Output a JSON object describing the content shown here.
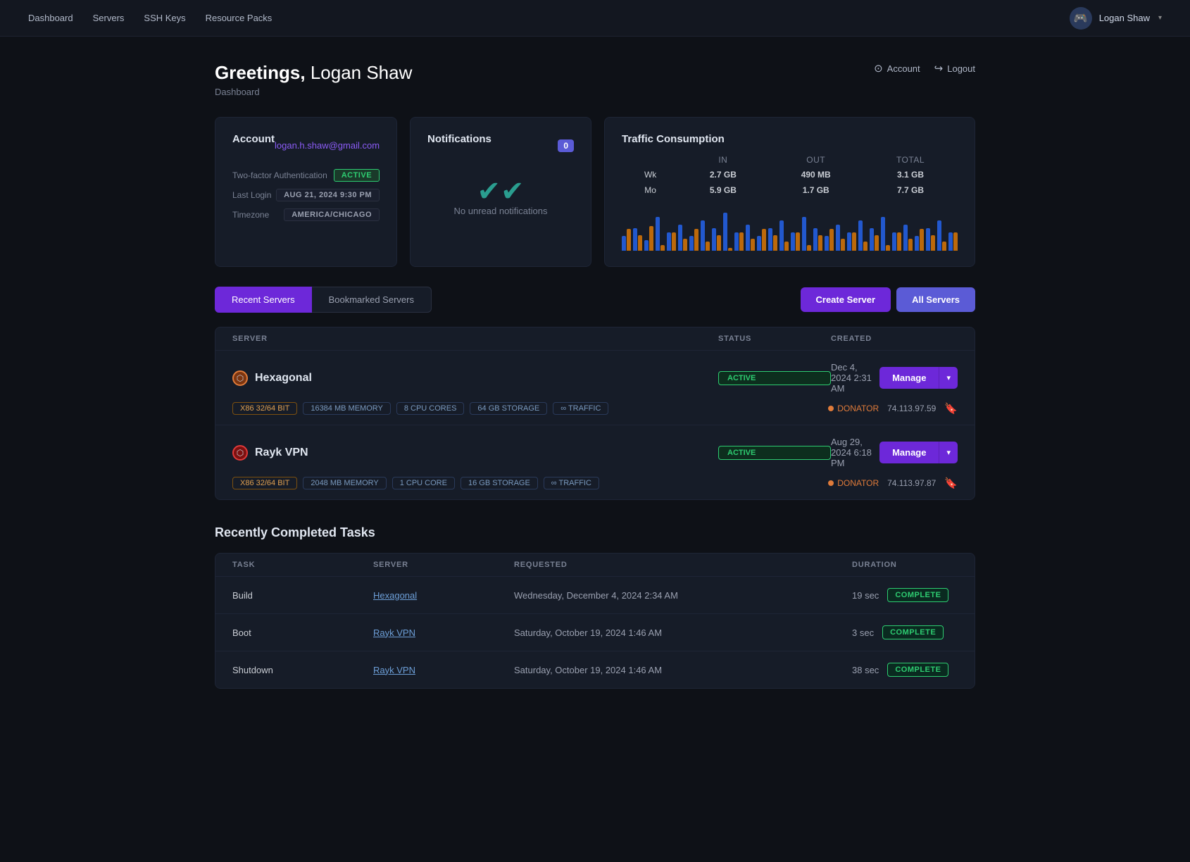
{
  "nav": {
    "links": [
      "Dashboard",
      "Servers",
      "SSH Keys",
      "Resource Packs"
    ],
    "username": "Logan Shaw",
    "avatar_emoji": "🎮"
  },
  "page_header": {
    "greeting": "Greetings,",
    "username": " Logan Shaw",
    "subtitle": "Dashboard",
    "actions": {
      "account_label": "Account",
      "logout_label": "Logout"
    }
  },
  "account_card": {
    "title": "Account",
    "email": "logan.h.shaw@gmail.com",
    "two_factor_label": "Two-factor Authentication",
    "two_factor_status": "ACTIVE",
    "last_login_label": "Last Login",
    "last_login_value": "AUG 21, 2024 9:30 PM",
    "timezone_label": "Timezone",
    "timezone_value": "AMERICA/CHICAGO"
  },
  "notifications_card": {
    "title": "Notifications",
    "count": "0",
    "empty_text": "No unread notifications"
  },
  "traffic_card": {
    "title": "Traffic Consumption",
    "headers": [
      "",
      "IN",
      "OUT",
      "TOTAL"
    ],
    "rows": [
      {
        "label": "Wk",
        "in": "2.7 GB",
        "out": "490 MB",
        "total": "3.1 GB"
      },
      {
        "label": "Mo",
        "in": "5.9 GB",
        "out": "1.7 GB",
        "total": "7.7 GB"
      }
    ],
    "chart_bars": [
      3,
      5,
      2,
      8,
      4,
      6,
      3,
      7,
      5,
      9,
      4,
      6,
      3,
      5,
      7,
      4,
      8,
      5,
      3,
      6,
      4,
      7,
      5,
      8,
      4,
      6,
      3,
      5,
      7,
      4
    ]
  },
  "tabs": {
    "active": "Recent Servers",
    "inactive": "Bookmarked Servers"
  },
  "buttons": {
    "create_server": "Create Server",
    "all_servers": "All Servers"
  },
  "servers_table": {
    "headers": {
      "server": "SERVER",
      "status": "STATUS",
      "created": "CREATED"
    },
    "rows": [
      {
        "icon_color": "orange",
        "name": "Hexagonal",
        "status": "ACTIVE",
        "created": "Dec 4, 2024 2:31 AM",
        "tags": [
          "X86 32/64 BIT",
          "16384 MB MEMORY",
          "8 CPU CORES",
          "64 GB STORAGE",
          "∞ TRAFFIC"
        ],
        "donator": "DONATOR",
        "ip": "74.113.97.59"
      },
      {
        "icon_color": "red",
        "name": "Rayk VPN",
        "status": "ACTIVE",
        "created": "Aug 29, 2024 6:18 PM",
        "tags": [
          "X86 32/64 BIT",
          "2048 MB MEMORY",
          "1 CPU CORE",
          "16 GB STORAGE",
          "∞ TRAFFIC"
        ],
        "donator": "DONATOR",
        "ip": "74.113.97.87"
      }
    ]
  },
  "tasks_section": {
    "title": "Recently Completed Tasks",
    "headers": {
      "task": "TASK",
      "server": "SERVER",
      "requested": "REQUESTED",
      "duration": "DURATION"
    },
    "rows": [
      {
        "task": "Build",
        "server": "Hexagonal",
        "requested": "Wednesday, December 4, 2024 2:34 AM",
        "duration": "19 sec",
        "status": "COMPLETE"
      },
      {
        "task": "Boot",
        "server": "Rayk VPN",
        "requested": "Saturday, October 19, 2024 1:46 AM",
        "duration": "3 sec",
        "status": "COMPLETE"
      },
      {
        "task": "Shutdown",
        "server": "Rayk VPN",
        "requested": "Saturday, October 19, 2024 1:46 AM",
        "duration": "38 sec",
        "status": "COMPLETE"
      }
    ]
  }
}
